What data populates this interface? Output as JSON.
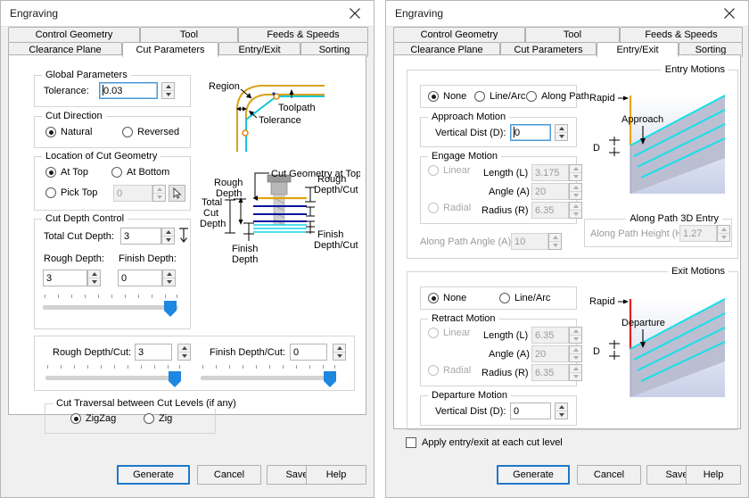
{
  "left_dialog": {
    "title": "Engraving",
    "close_icon": "close-icon",
    "tabs_row1": [
      {
        "label": "Control Geometry",
        "active": false
      },
      {
        "label": "Tool",
        "active": false
      },
      {
        "label": "Feeds & Speeds",
        "active": false
      }
    ],
    "tabs_row2": [
      {
        "label": "Clearance Plane",
        "active": false
      },
      {
        "label": "Cut Parameters",
        "active": true
      },
      {
        "label": "Entry/Exit",
        "active": false
      },
      {
        "label": "Sorting",
        "active": false
      }
    ],
    "global_parameters": {
      "legend": "Global Parameters",
      "tolerance_label": "Tolerance:",
      "tolerance_value": "0.03"
    },
    "cut_direction": {
      "legend": "Cut Direction",
      "natural_label": "Natural",
      "reversed_label": "Reversed",
      "selected": "Natural"
    },
    "location_of_cut_geometry": {
      "legend": "Location of Cut Geometry",
      "at_top_label": "At Top",
      "at_bottom_label": "At Bottom",
      "pick_top_label": "Pick Top",
      "pick_top_value": "0",
      "selected": "At Top",
      "pick_icon": "cursor-pick-icon"
    },
    "cut_depth_control": {
      "legend": "Cut Depth Control",
      "total_cut_depth_label": "Total Cut Depth:",
      "total_cut_depth_value": "3",
      "depth_direction_icon": "depth-direction-icon",
      "rough_depth_label": "Rough Depth:",
      "rough_depth_value": "3",
      "finish_depth_label": "Finish Depth:",
      "finish_depth_value": "0"
    },
    "depth_per_cut": {
      "rough_depth_cut_label": "Rough Depth/Cut:",
      "rough_depth_cut_value": "3",
      "finish_depth_cut_label": "Finish Depth/Cut:",
      "finish_depth_cut_value": "0"
    },
    "cut_traversal": {
      "legend": "Cut Traversal between Cut Levels (if any)",
      "zigzag_label": "ZigZag",
      "zig_label": "Zig",
      "selected": "ZigZag"
    },
    "tolerance_diagram": {
      "region_label": "Region",
      "toolpath_label": "Toolpath",
      "tolerance_label": "Tolerance"
    },
    "depth_diagram": {
      "cut_geometry_at_top_label": "Cut Geometry at Top",
      "rough_depth_label_line1": "Rough",
      "rough_depth_label_line2": "Depth",
      "total_cut_depth_line1": "Total",
      "total_cut_depth_line2": "Cut",
      "total_cut_depth_line3": "Depth",
      "finish_depth_line1": "Finish",
      "finish_depth_line2": "Depth",
      "rough_depth_cut_line1": "Rough",
      "rough_depth_cut_line2": "Depth/Cut",
      "finish_depth_cut_line1": "Finish",
      "finish_depth_cut_line2": "Depth/Cut"
    },
    "buttons": {
      "generate": "Generate",
      "cancel": "Cancel",
      "save": "Save",
      "help": "Help"
    }
  },
  "right_dialog": {
    "title": "Engraving",
    "close_icon": "close-icon",
    "tabs_row1": [
      {
        "label": "Control Geometry",
        "active": false
      },
      {
        "label": "Tool",
        "active": false
      },
      {
        "label": "Feeds & Speeds",
        "active": false
      }
    ],
    "tabs_row2": [
      {
        "label": "Clearance Plane",
        "active": false
      },
      {
        "label": "Cut Parameters",
        "active": false
      },
      {
        "label": "Entry/Exit",
        "active": true
      },
      {
        "label": "Sorting",
        "active": false
      }
    ],
    "entry_motions": {
      "legend": "Entry Motions",
      "mode_none": "None",
      "mode_line_arc": "Line/Arc",
      "mode_along_path": "Along Path",
      "mode_selected": "None",
      "approach_motion": {
        "legend": "Approach Motion",
        "vertical_dist_label": "Vertical Dist (D):",
        "vertical_dist_value": "0"
      },
      "engage_motion": {
        "legend": "Engage Motion",
        "linear_label": "Linear",
        "radial_label": "Radial",
        "length_label": "Length (L)",
        "length_value": "3.175",
        "angle_label": "Angle (A)",
        "angle_value": "20",
        "radius_label": "Radius (R)",
        "radius_value": "6.35"
      },
      "along_path_angle_label": "Along Path Angle (A)",
      "along_path_angle_value": "10",
      "along_path_3d_entry": {
        "legend": "Along Path 3D Entry",
        "height_label": "Along Path Height (H)",
        "height_value": "1.27"
      },
      "diagram": {
        "rapid_label": "Rapid",
        "approach_label": "Approach",
        "d_label": "D"
      }
    },
    "exit_motions": {
      "legend": "Exit Motions",
      "mode_none": "None",
      "mode_line_arc": "Line/Arc",
      "mode_selected": "None",
      "retract_motion": {
        "legend": "Retract Motion",
        "linear_label": "Linear",
        "radial_label": "Radial",
        "length_label": "Length (L)",
        "length_value": "6.35",
        "angle_label": "Angle (A)",
        "angle_value": "20",
        "radius_label": "Radius (R)",
        "radius_value": "6.35"
      },
      "departure_motion": {
        "legend": "Departure Motion",
        "vertical_dist_label": "Vertical Dist (D):",
        "vertical_dist_value": "0"
      },
      "diagram": {
        "rapid_label": "Rapid",
        "departure_label": "Departure",
        "d_label": "D"
      }
    },
    "apply_each_cut_level": {
      "label": "Apply entry/exit at each cut level",
      "checked": false
    },
    "buttons": {
      "generate": "Generate",
      "cancel": "Cancel",
      "save": "Save",
      "help": "Help"
    }
  },
  "colors": {
    "accent_blue": "#1e87e0",
    "default_button_border": "#1e78c8",
    "region_orange": "#d8a318",
    "toolpath_cyan": "#12c8d8",
    "rapid_yellow": "#e8a910",
    "rapid_red": "#e02020"
  }
}
